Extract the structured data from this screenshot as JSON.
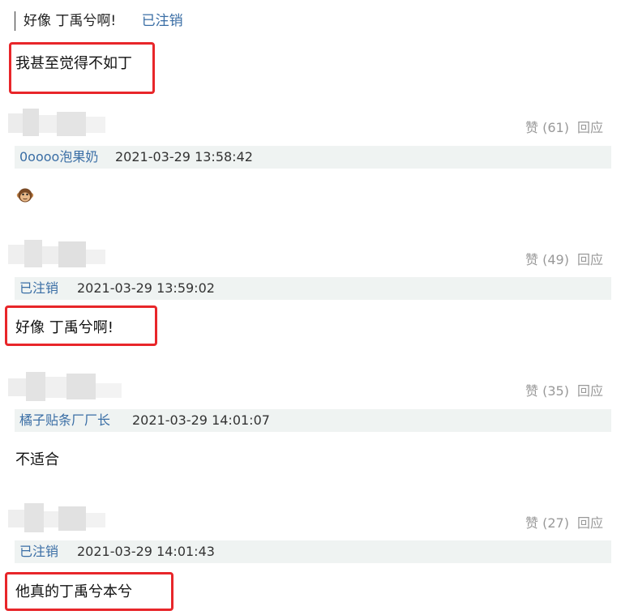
{
  "quoted": {
    "text": "好像 丁禹兮啊!",
    "user": "已注销"
  },
  "top_reply": {
    "text": "我甚至觉得不如丁"
  },
  "comments": [
    {
      "user": "0oooo泡果奶",
      "time": "2021-03-29 13:58:42",
      "likes": "赞 (61)",
      "reply": "回应",
      "content": "",
      "emoji": "monkey-emoji"
    },
    {
      "user": "已注销",
      "time": "2021-03-29 13:59:02",
      "likes": "赞 (49)",
      "reply": "回应",
      "content": "好像 丁禹兮啊!"
    },
    {
      "user": "橘子贴条厂厂长",
      "time": "2021-03-29 14:01:07",
      "likes": "赞 (35)",
      "reply": "回应",
      "content": "不适合"
    },
    {
      "user": "已注销",
      "time": "2021-03-29 14:01:43",
      "likes": "赞 (27)",
      "reply": "回应",
      "content": "他真的丁禹兮本兮"
    }
  ],
  "colors": {
    "link": "#3a6ea5",
    "meta_bg": "#eff3f2",
    "highlight": "#e8262a",
    "muted": "#999999"
  }
}
